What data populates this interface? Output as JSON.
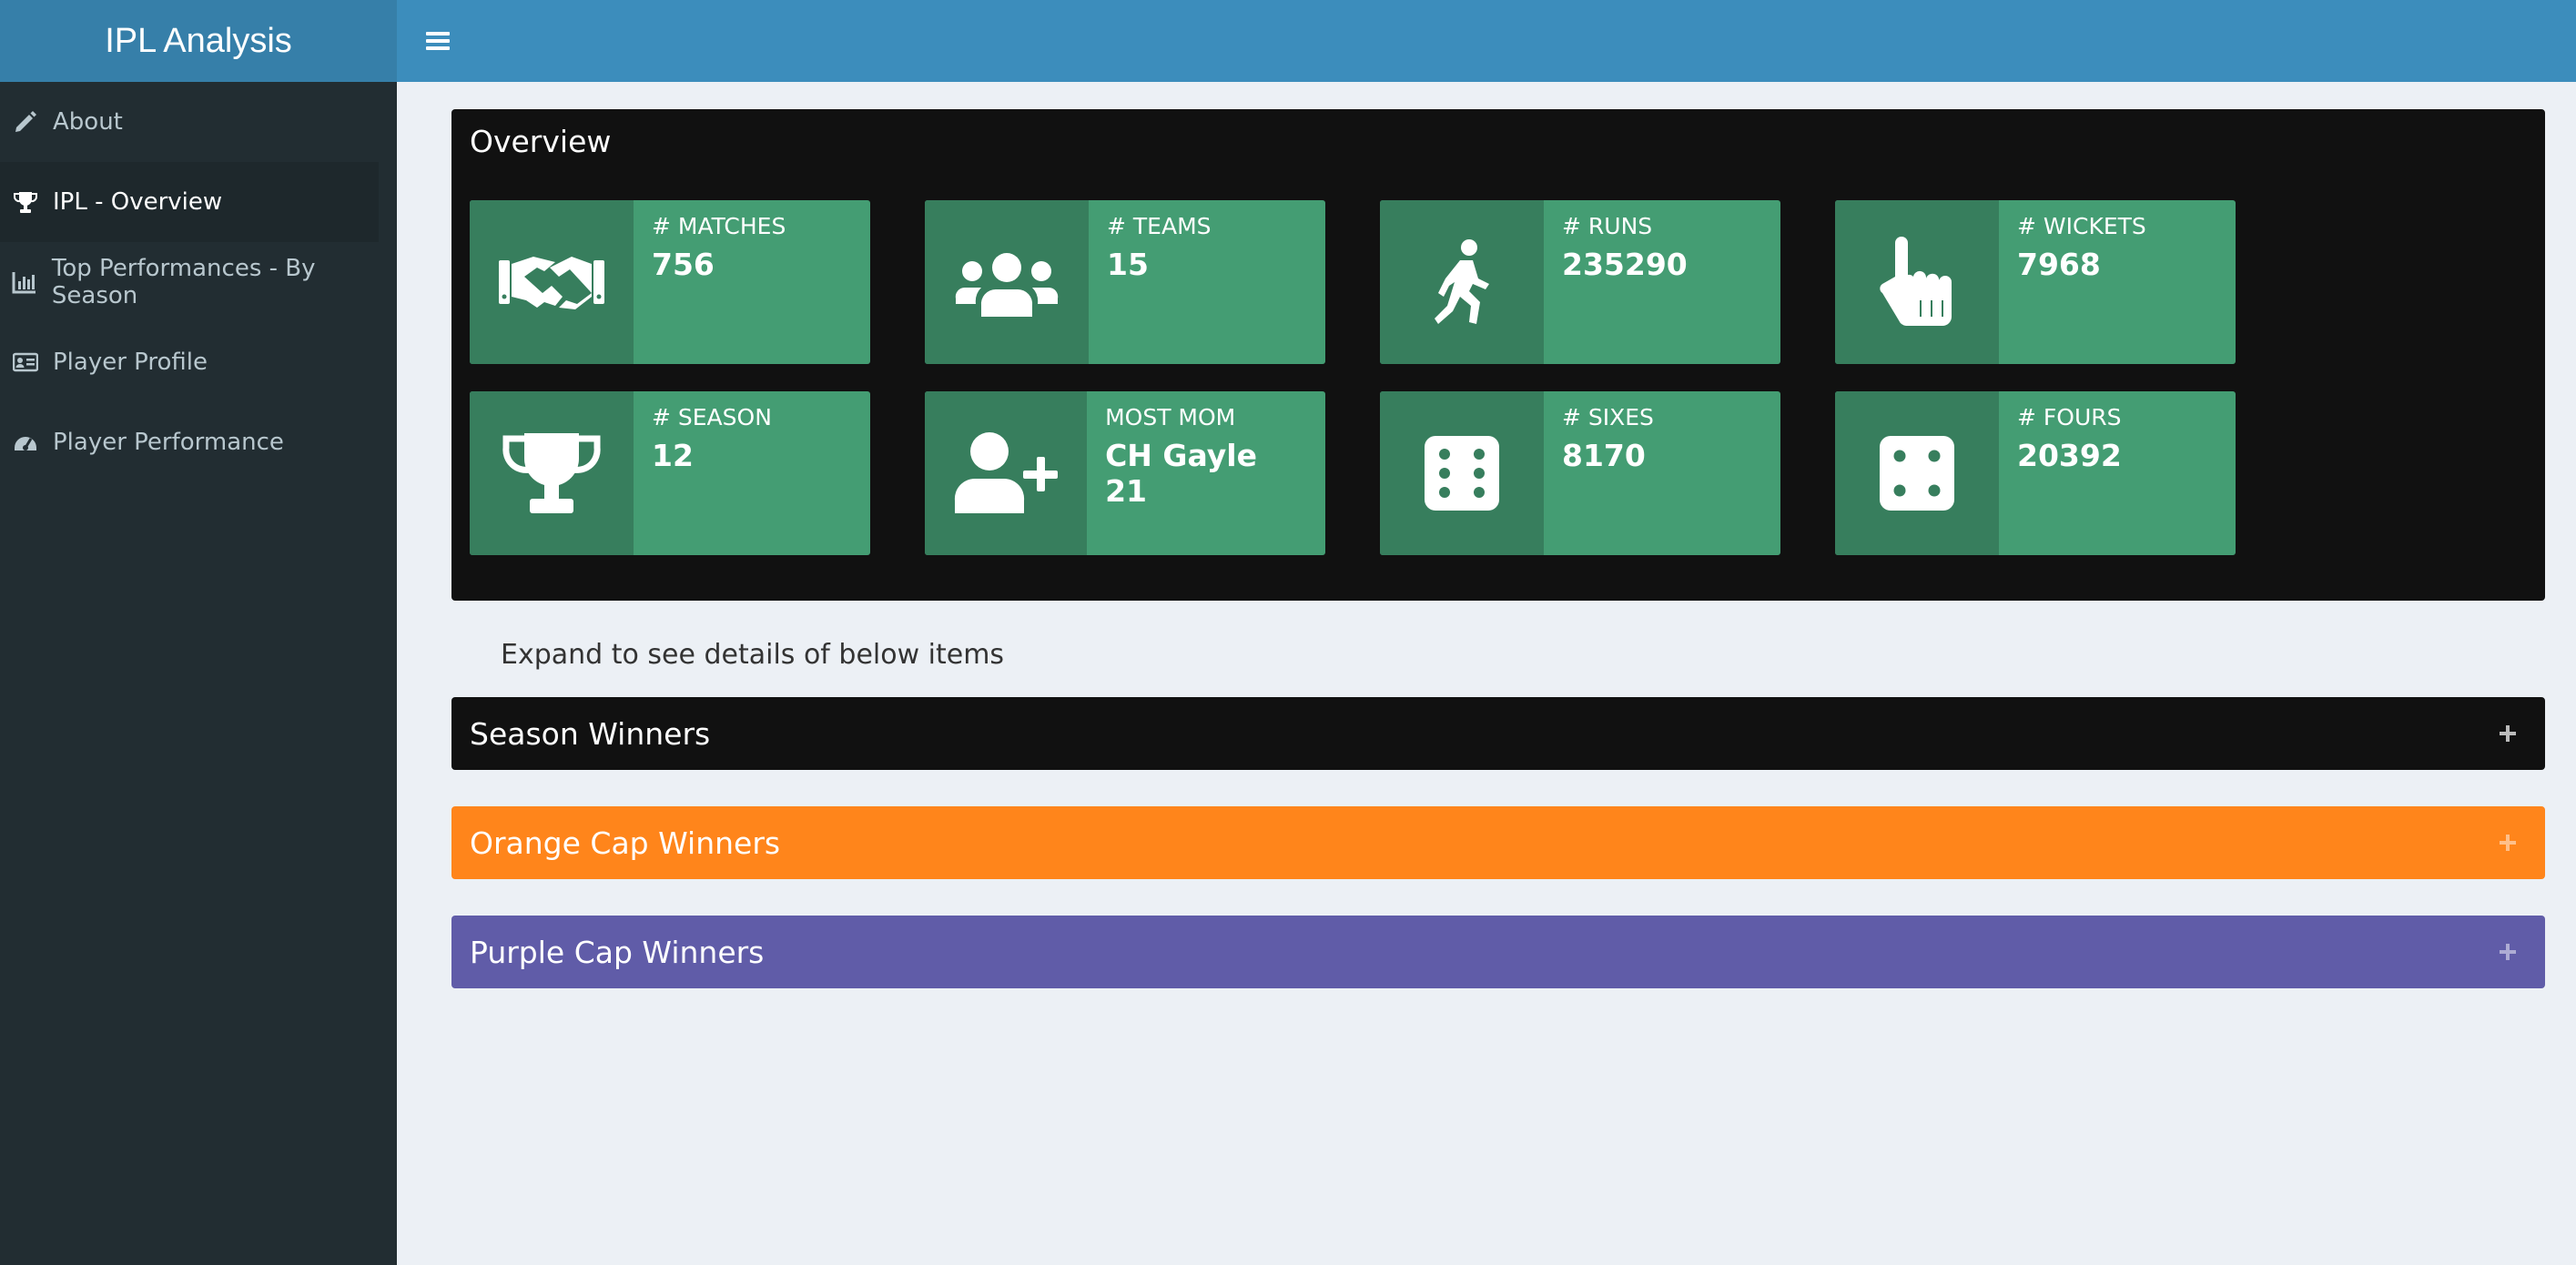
{
  "app": {
    "title": "IPL Analysis"
  },
  "sidebar": {
    "items": [
      {
        "label": "About",
        "icon": "pencil-icon"
      },
      {
        "label": "IPL - Overview",
        "icon": "trophy-icon",
        "active": true
      },
      {
        "label": "Top Performances - By Season",
        "icon": "bar-chart-icon"
      },
      {
        "label": "Player Profile",
        "icon": "id-card-icon"
      },
      {
        "label": "Player Performance",
        "icon": "tachometer-icon"
      }
    ]
  },
  "overview": {
    "title": "Overview",
    "cards": [
      {
        "label": "# MATCHES",
        "value": "756",
        "icon": "handshake-icon"
      },
      {
        "label": "# TEAMS",
        "value": "15",
        "icon": "users-icon"
      },
      {
        "label": "# RUNS",
        "value": "235290",
        "icon": "running-person-icon"
      },
      {
        "label": "# WICKETS",
        "value": "7968",
        "icon": "pointing-hand-icon"
      },
      {
        "label": "# SEASON",
        "value": "12",
        "icon": "trophy-icon"
      },
      {
        "label": "MOST MOM",
        "value": "CH Gayle 21",
        "icon": "user-plus-icon"
      },
      {
        "label": "# SIXES",
        "value": "8170",
        "icon": "dice-six-icon"
      },
      {
        "label": "# FOURS",
        "value": "20392",
        "icon": "dice-four-icon"
      }
    ]
  },
  "hint": "Expand to see details of below items",
  "panels": [
    {
      "title": "Season Winners",
      "color": "#111111"
    },
    {
      "title": "Orange Cap Winners",
      "color": "#ff851b"
    },
    {
      "title": "Purple Cap Winners",
      "color": "#605ca8"
    }
  ],
  "colors": {
    "header": "#3c8dbc",
    "logo": "#367fa9",
    "sidebar": "#222d32",
    "card": "#449d73",
    "card_icon_bg": "#377e5d"
  }
}
